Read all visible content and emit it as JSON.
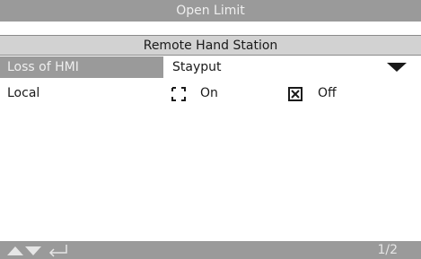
{
  "header": {
    "title": "Open Limit"
  },
  "section": {
    "title": "Remote Hand Station"
  },
  "rows": [
    {
      "label": "Loss of HMI",
      "value": "Stayput"
    },
    {
      "label": "Local",
      "options": [
        {
          "label": "On",
          "checked": false
        },
        {
          "label": "Off",
          "checked": true
        }
      ]
    }
  ],
  "footer": {
    "page": "1/2",
    "icons": [
      "up-arrow-icon",
      "down-arrow-icon",
      "enter-icon"
    ]
  }
}
